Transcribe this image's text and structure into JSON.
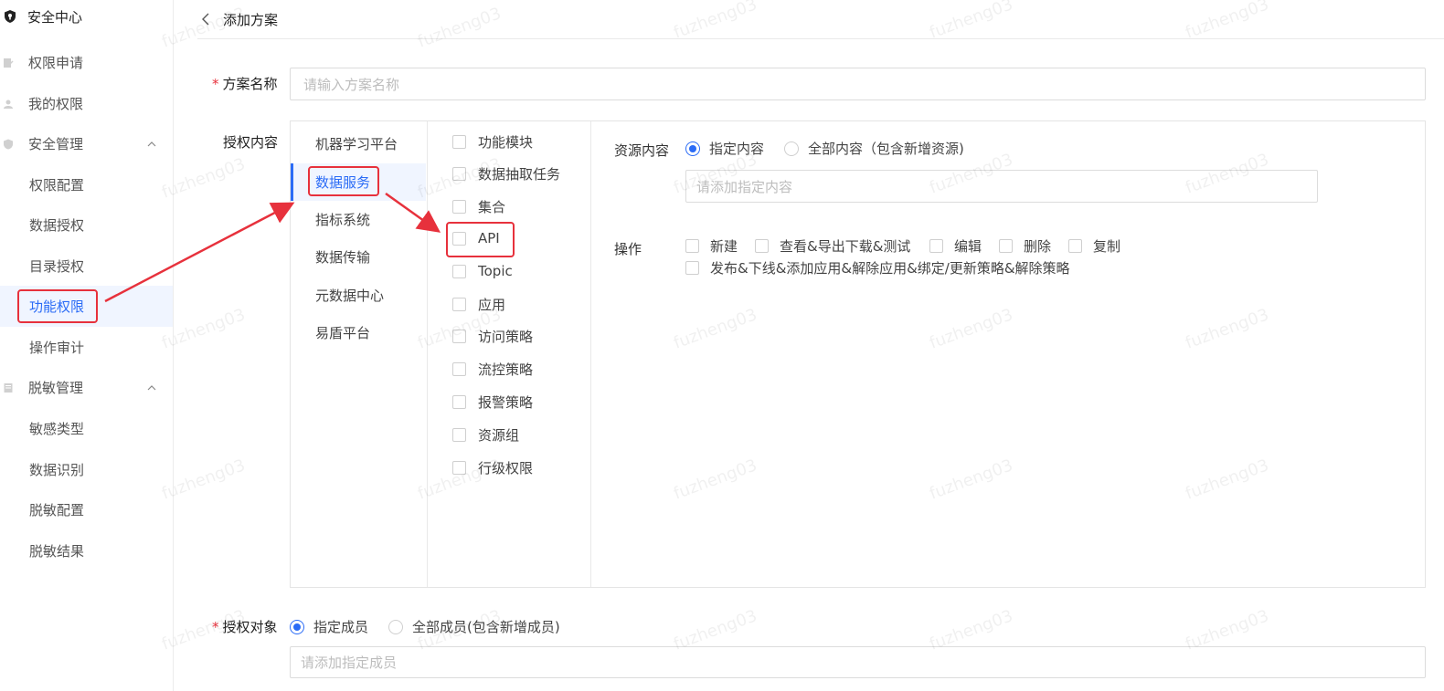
{
  "sidebar": {
    "header": "安全中心",
    "items": [
      {
        "label": "权限申请",
        "level": 1
      },
      {
        "label": "我的权限",
        "level": 1
      },
      {
        "label": "安全管理",
        "level": 1,
        "expanded": true
      },
      {
        "label": "权限配置",
        "level": 2
      },
      {
        "label": "数据授权",
        "level": 2
      },
      {
        "label": "目录授权",
        "level": 2
      },
      {
        "label": "功能权限",
        "level": 2,
        "active": true
      },
      {
        "label": "操作审计",
        "level": 2
      },
      {
        "label": "脱敏管理",
        "level": 1,
        "expanded": true
      },
      {
        "label": "敏感类型",
        "level": 2
      },
      {
        "label": "数据识别",
        "level": 2
      },
      {
        "label": "脱敏配置",
        "level": 2
      },
      {
        "label": "脱敏结果",
        "level": 2
      }
    ]
  },
  "header": {
    "title": "添加方案"
  },
  "form": {
    "plan_name_label": "方案名称",
    "plan_name_placeholder": "请输入方案名称",
    "auth_content_label": "授权内容",
    "platforms": [
      "机器学习平台",
      "数据服务",
      "指标系统",
      "数据传输",
      "元数据中心",
      "易盾平台"
    ],
    "modules": [
      "功能模块",
      "数据抽取任务",
      "集合",
      "API",
      "Topic",
      "应用",
      "访问策略",
      "流控策略",
      "报警策略",
      "资源组",
      "行级权限"
    ],
    "resource_label": "资源内容",
    "resource_options": [
      "指定内容",
      "全部内容（包含新增资源)"
    ],
    "resource_placeholder": "请添加指定内容",
    "ops_label": "操作",
    "ops": [
      "新建",
      "查看&导出下载&测试",
      "编辑",
      "删除",
      "复制",
      "发布&下线&添加应用&解除应用&绑定/更新策略&解除策略"
    ],
    "target_label": "授权对象",
    "target_options": [
      "指定成员",
      "全部成员(包含新增成员)"
    ],
    "target_placeholder": "请添加指定成员"
  },
  "watermark": "fuzheng03",
  "colors": {
    "accent": "#2b6cf6",
    "highlight": "#e7313c"
  }
}
